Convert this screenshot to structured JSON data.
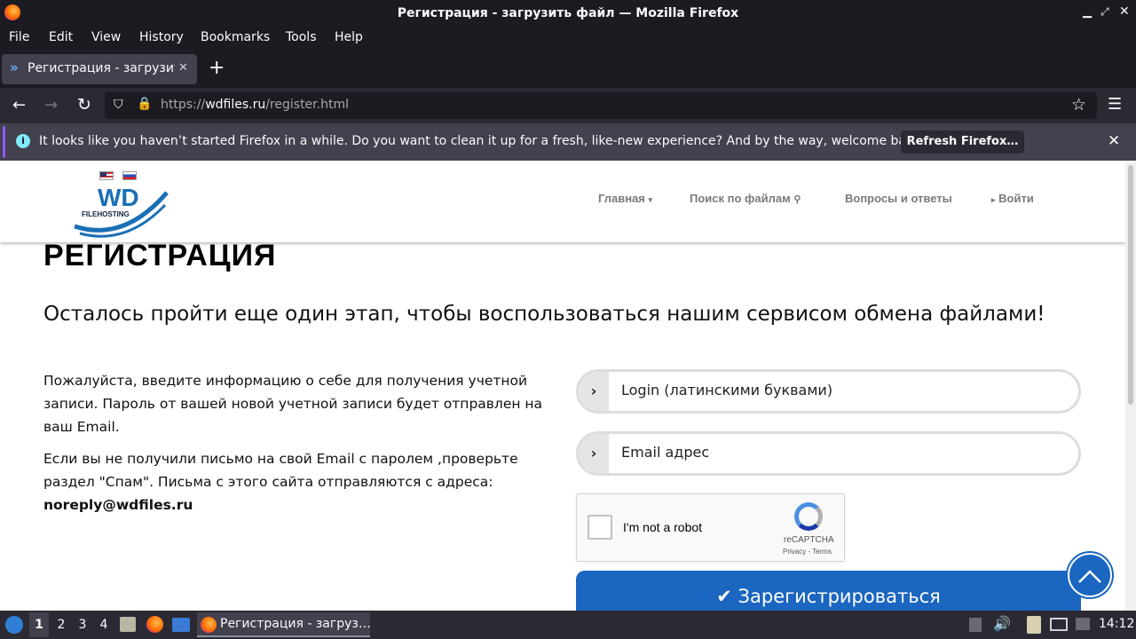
{
  "window": {
    "title": "Регистрация - загрузить файл — Mozilla Firefox"
  },
  "menu": [
    "File",
    "Edit",
    "View",
    "History",
    "Bookmarks",
    "Tools",
    "Help"
  ],
  "tab": {
    "label": "Регистрация - загрузить ф"
  },
  "url": {
    "prefix": "https://",
    "domain": "wdfiles.ru",
    "path": "/register.html"
  },
  "notification": {
    "text": "It looks like you haven’t started Firefox in a while. Do you want to clean it up for a fresh, like-new experience? And by the way, welcome back!",
    "button": "Refresh Firefox…"
  },
  "site": {
    "logo_text": "WD",
    "logo_sub": "FILEHOSTING",
    "nav": {
      "home": "Главная",
      "search": "Поиск по файлам",
      "faq": "Вопросы и ответы",
      "login": "Войти"
    },
    "heading": "РЕГИСТРАЦИЯ",
    "subheading": "Осталось пройти еще один этап, чтобы воспользоваться нашим сервисом обмена файлами!",
    "para1": "Пожалуйста, введите информацию о себе для получения учетной записи. Пароль от вашей новой учетной записи будет отправлен на ваш Email.",
    "para2": "Если вы не получили письмо на свой Email с паролем ,проверьте раздел \"Спам\". Письма с этого сайта отправляются с адреса:",
    "email": "noreply@wdfiles.ru",
    "login_placeholder": "Login (латинскими буквами)",
    "email_placeholder": "Email адрес",
    "captcha": {
      "label": "I'm not a robot",
      "brand": "reCAPTCHA",
      "links": "Privacy - Terms"
    },
    "register_button": "Зарегистрироваться"
  },
  "taskbar": {
    "workspaces": [
      "1",
      "2",
      "3",
      "4"
    ],
    "task": "Регистрация - загруз…",
    "clock": "14:12"
  }
}
